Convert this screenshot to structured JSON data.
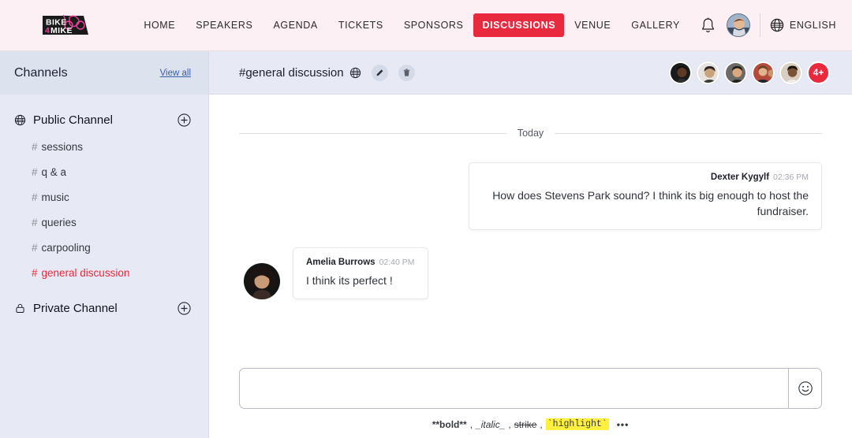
{
  "brand": {
    "logo_line1": "BIKE",
    "logo_line2": "MIKE",
    "logo_number": "4",
    "accent_color": "#e8293e",
    "header_bg": "#fdf0f5"
  },
  "topnav": {
    "links": [
      {
        "label": "HOME",
        "active": false
      },
      {
        "label": "SPEAKERS",
        "active": false
      },
      {
        "label": "AGENDA",
        "active": false
      },
      {
        "label": "TICKETS",
        "active": false
      },
      {
        "label": "SPONSORS",
        "active": false
      },
      {
        "label": "DISCUSSIONS",
        "active": true
      },
      {
        "label": "VENUE",
        "active": false
      },
      {
        "label": "GALLERY",
        "active": false
      }
    ],
    "bell_icon": "bell-icon",
    "user_avatar": "user-avatar",
    "language": {
      "icon": "globe-icon",
      "label": "ENGLISH"
    }
  },
  "sidebar": {
    "title": "Channels",
    "view_all": "View all",
    "groups": [
      {
        "name": "Public Channel",
        "icon": "globe-icon",
        "add_icon": "plus-circle-icon",
        "channels": [
          {
            "name": "sessions",
            "active": false
          },
          {
            "name": "q & a",
            "active": false
          },
          {
            "name": "music",
            "active": false
          },
          {
            "name": "queries",
            "active": false
          },
          {
            "name": "carpooling",
            "active": false
          },
          {
            "name": "general discussion",
            "active": true
          }
        ]
      },
      {
        "name": "Private Channel",
        "icon": "lock-icon",
        "add_icon": "plus-circle-icon",
        "channels": []
      }
    ],
    "hash_symbol": "#"
  },
  "channel_header": {
    "hash": "#",
    "title": "general discussion",
    "visibility_icon": "globe-icon",
    "edit_icon": "pencil-icon",
    "delete_icon": "trash-icon",
    "members": [
      {
        "name": "member-1"
      },
      {
        "name": "member-2"
      },
      {
        "name": "member-3"
      },
      {
        "name": "member-4"
      },
      {
        "name": "member-5"
      }
    ],
    "overflow_count": "4+"
  },
  "conversation": {
    "day_divider": "Today",
    "messages": [
      {
        "author": "Dexter Kygylf",
        "time": "02:36 PM",
        "text": "How does Stevens Park sound? I think its big enough to host the fundraiser.",
        "outgoing": true,
        "avatar": ""
      },
      {
        "author": "Amelia Burrows",
        "time": "02:40 PM",
        "text": "I think its perfect !",
        "outgoing": false,
        "avatar": "amelia-avatar"
      }
    ]
  },
  "composer": {
    "value": "",
    "placeholder": "",
    "emoji_icon": "smiley-icon",
    "format_hints": {
      "bold": "**bold**",
      "comma": ",",
      "italic": "_italic_",
      "strike": "strike",
      "highlight": "`highlight`",
      "more": "•••"
    }
  }
}
